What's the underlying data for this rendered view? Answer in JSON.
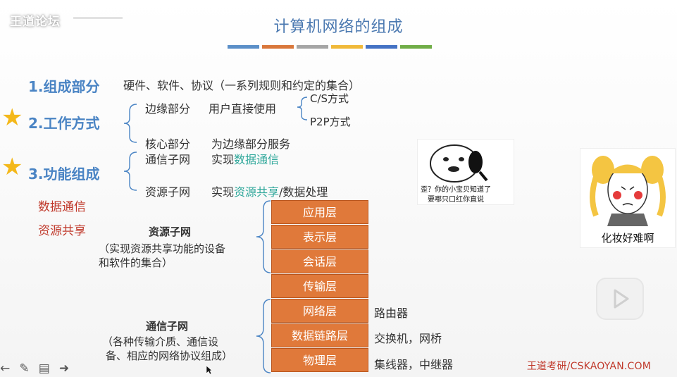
{
  "watermark": "王道论坛",
  "title": "计算机网络的组成",
  "accent_bars": [
    "#5b8fc8",
    "#d9773b",
    "#a5a5a5",
    "#f0b939",
    "#4472c4",
    "#70ad47"
  ],
  "section1": {
    "label": "1.组成部分",
    "text": "硬件、软件、协议（一系列规则和约定的集合）"
  },
  "section2": {
    "label": "2.工作方式",
    "edge": "边缘部分",
    "edge_desc": "用户直接使用",
    "cs": "C/S方式",
    "p2p": "P2P方式",
    "core": "核心部分",
    "core_desc": "为边缘部分服务"
  },
  "section3": {
    "label": "3.功能组成",
    "comm": "通信子网",
    "comm_pre": "实现",
    "comm_hl": "数据通信",
    "res": "资源子网",
    "res_pre": "实现",
    "res_hl": "资源共享",
    "res_post": "/数据处理"
  },
  "red_notes": [
    "数据通信",
    "资源共享"
  ],
  "res_subnet": {
    "title": "资源子网",
    "line1": "（实现资源共享功能的设备",
    "line2": "和软件的集合）"
  },
  "comm_subnet": {
    "title": "通信子网",
    "line1": "（各种传输介质、通信设",
    "line2": "备、相应的网络协议组成）"
  },
  "layers": [
    "应用层",
    "表示层",
    "会话层",
    "传输层",
    "网络层",
    "数据链路层",
    "物理层"
  ],
  "devices": {
    "network": "路由器",
    "datalink": "交换机，网桥",
    "physical": "集线器，中继器"
  },
  "meme1": {
    "line1": "歪？你的小宝贝知道了",
    "line2": "要哪只口红你直说"
  },
  "meme2": {
    "caption": "化妆好难啊"
  },
  "footer": "王道考研/CSKAOYAN.COM",
  "toolbar": {
    "prev": "←",
    "pen": "✎",
    "menu": "▤",
    "next": "➜"
  }
}
